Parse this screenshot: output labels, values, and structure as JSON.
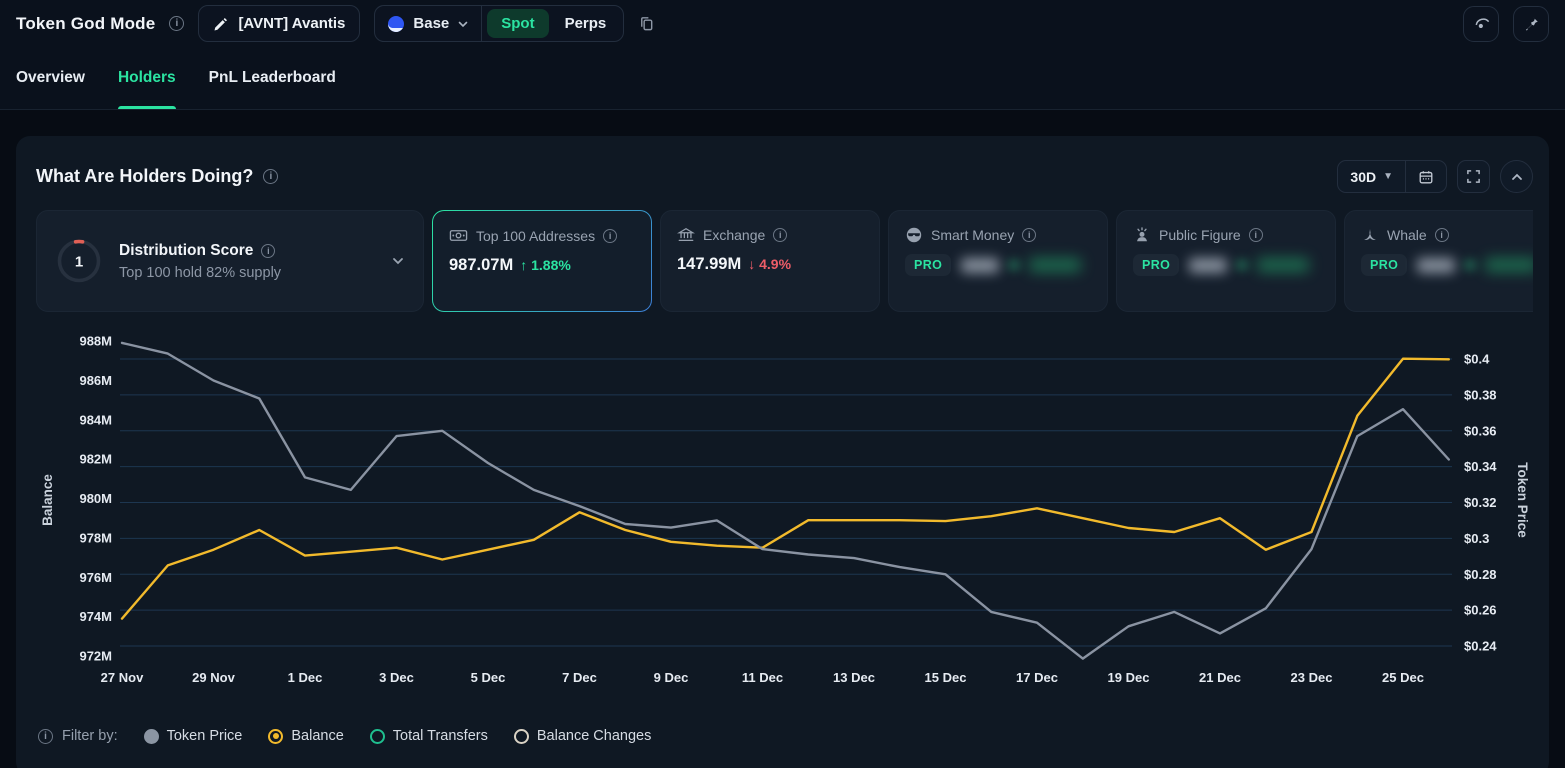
{
  "header": {
    "title": "Token God Mode",
    "token_pill": "[AVNT] Avantis",
    "chain": "Base",
    "market_tabs": {
      "spot": "Spot",
      "perps": "Perps"
    },
    "active_market_tab": "Spot"
  },
  "nav_tabs": {
    "overview": "Overview",
    "holders": "Holders",
    "pnl": "PnL Leaderboard",
    "active": "Holders"
  },
  "panel": {
    "title": "What Are Holders Doing?",
    "range": "30D"
  },
  "cards": [
    {
      "type": "gauge",
      "score": "1",
      "title": "Distribution Score",
      "subtitle": "Top 100 hold 82% supply"
    },
    {
      "type": "value",
      "title": "Top 100 Addresses",
      "value": "987.07M",
      "arrow": "↑",
      "change": "1.88%",
      "direction": "up",
      "selected": true
    },
    {
      "type": "value",
      "title": "Exchange",
      "value": "147.99M",
      "arrow": "↓",
      "change": "4.9%",
      "direction": "down"
    },
    {
      "type": "pro",
      "title": "Smart Money",
      "badge": "PRO"
    },
    {
      "type": "pro",
      "title": "Public Figure",
      "badge": "PRO"
    },
    {
      "type": "pro",
      "title": "Whale",
      "badge": "PRO"
    }
  ],
  "colors": {
    "accent_green": "#2be3a1",
    "negative_red": "#ee5d68",
    "balance_line": "#f2ba2c",
    "price_line": "#8a93a2",
    "gridline": "#1d3650",
    "panel_bg": "#0f1823",
    "card_bg": "#151f2c"
  },
  "chart_data": {
    "type": "line",
    "x": [
      "27 Nov",
      "28 Nov",
      "29 Nov",
      "30 Nov",
      "1 Dec",
      "2 Dec",
      "3 Dec",
      "4 Dec",
      "5 Dec",
      "6 Dec",
      "7 Dec",
      "8 Dec",
      "9 Dec",
      "10 Dec",
      "11 Dec",
      "12 Dec",
      "13 Dec",
      "14 Dec",
      "15 Dec",
      "16 Dec",
      "17 Dec",
      "18 Dec",
      "19 Dec",
      "20 Dec",
      "21 Dec",
      "22 Dec",
      "23 Dec",
      "24 Dec",
      "25 Dec",
      "26 Dec"
    ],
    "x_tick_labels": [
      "27 Nov",
      "29 Nov",
      "1 Dec",
      "3 Dec",
      "5 Dec",
      "7 Dec",
      "9 Dec",
      "11 Dec",
      "13 Dec",
      "15 Dec",
      "17 Dec",
      "19 Dec",
      "21 Dec",
      "23 Dec",
      "25 Dec"
    ],
    "series": [
      {
        "name": "Balance",
        "axis": "left",
        "color": "#f2ba2c",
        "values": [
          973.9,
          976.6,
          977.4,
          978.4,
          977.1,
          977.3,
          977.5,
          976.9,
          977.4,
          977.9,
          979.3,
          978.4,
          977.8,
          977.6,
          977.5,
          978.9,
          978.9,
          978.9,
          978.85,
          979.1,
          979.5,
          979.0,
          978.5,
          978.3,
          979.0,
          977.4,
          978.3,
          984.2,
          987.1,
          987.07
        ]
      },
      {
        "name": "Token Price",
        "axis": "right",
        "color": "#8a93a2",
        "values": [
          0.409,
          0.403,
          0.388,
          0.378,
          0.334,
          0.327,
          0.357,
          0.36,
          0.342,
          0.327,
          0.318,
          0.308,
          0.306,
          0.31,
          0.294,
          0.291,
          0.289,
          0.284,
          0.28,
          0.259,
          0.253,
          0.233,
          0.251,
          0.259,
          0.247,
          0.261,
          0.294,
          0.357,
          0.372,
          0.344
        ]
      }
    ],
    "left_axis": {
      "label": "Balance",
      "unit": "M",
      "ticks": [
        988,
        986,
        984,
        982,
        980,
        978,
        976,
        974,
        972
      ]
    },
    "right_axis": {
      "label": "Token Price",
      "unit": "$",
      "ticks": [
        0.4,
        0.38,
        0.36,
        0.34,
        0.32,
        0.3,
        0.28,
        0.26,
        0.24
      ]
    },
    "grid": "horizontal",
    "legend_position": "none"
  },
  "filter": {
    "lead": "Filter by:",
    "items": [
      {
        "label": "Token Price",
        "style": "filled",
        "color": "#8b95a3",
        "selected": false
      },
      {
        "label": "Balance",
        "style": "radio",
        "color": "#f2ba2c",
        "selected": true
      },
      {
        "label": "Total Transfers",
        "style": "ring",
        "color": "#1fbf8f",
        "selected": false
      },
      {
        "label": "Balance Changes",
        "style": "ring",
        "color": "#d9d2c4",
        "selected": false
      }
    ]
  }
}
